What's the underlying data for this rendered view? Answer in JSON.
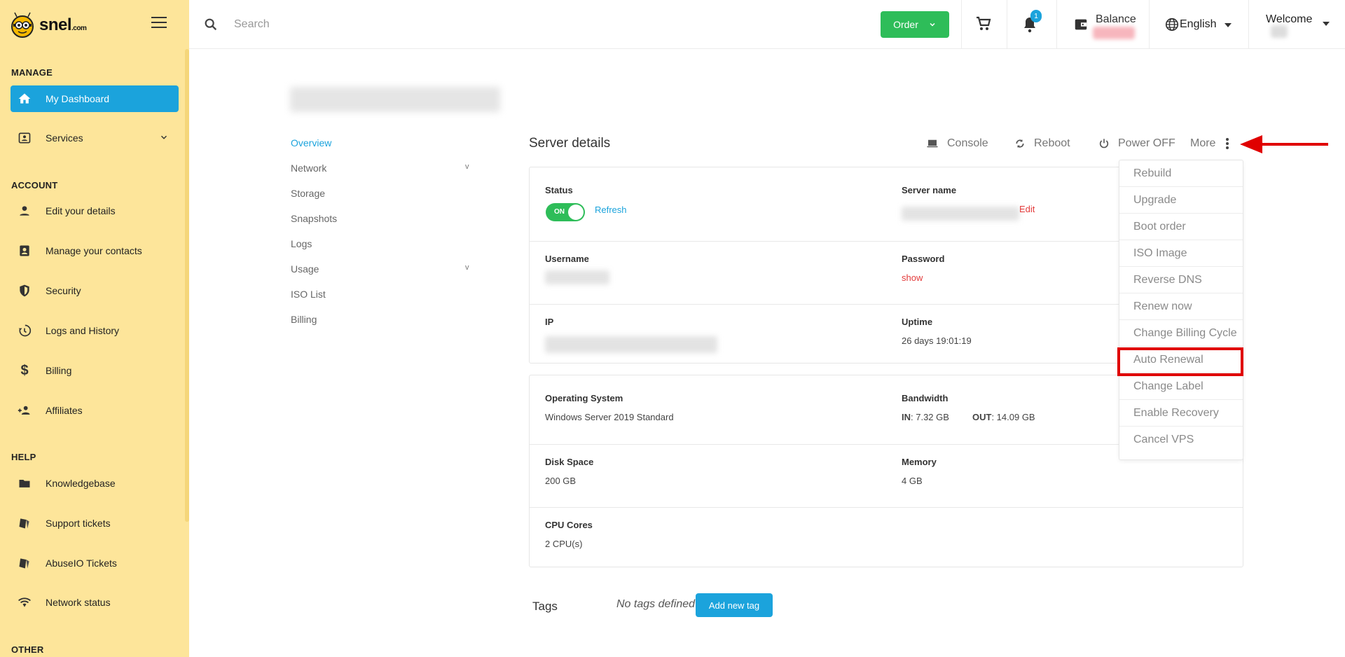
{
  "brand": {
    "name": "snel",
    "suffix": ".com"
  },
  "sidebar": {
    "sections": {
      "manage": "MANAGE",
      "account": "ACCOUNT",
      "help": "HELP",
      "other": "OTHER"
    },
    "items": [
      {
        "label": "My Dashboard",
        "icon": "home-icon"
      },
      {
        "label": "Services",
        "icon": "services-icon"
      },
      {
        "label": "Edit your details",
        "icon": "person-icon"
      },
      {
        "label": "Manage your contacts",
        "icon": "contacts-icon"
      },
      {
        "label": "Security",
        "icon": "shield-icon"
      },
      {
        "label": "Logs and History",
        "icon": "history-icon"
      },
      {
        "label": "Billing",
        "icon": "dollar-icon"
      },
      {
        "label": "Affiliates",
        "icon": "people-add-icon"
      },
      {
        "label": "Knowledgebase",
        "icon": "folder-icon"
      },
      {
        "label": "Support tickets",
        "icon": "ticket-icon"
      },
      {
        "label": "AbuseIO Tickets",
        "icon": "ticket-icon"
      },
      {
        "label": "Network status",
        "icon": "wifi-icon"
      }
    ]
  },
  "topbar": {
    "search_placeholder": "Search",
    "order_label": "Order",
    "notifications_count": "1",
    "balance_label": "Balance",
    "language_label": "English",
    "welcome_label": "Welcome"
  },
  "subnav": {
    "items": [
      "Overview",
      "Network",
      "Storage",
      "Snapshots",
      "Logs",
      "Usage",
      "ISO List",
      "Billing"
    ],
    "expand_marker": "v"
  },
  "server": {
    "title": "Server details",
    "actions": {
      "console": "Console",
      "reboot": "Reboot",
      "power_off": "Power OFF",
      "more": "More"
    },
    "status_label": "Status",
    "toggle_text": "ON",
    "refresh": "Refresh",
    "server_name_label": "Server name",
    "edit": "Edit",
    "username_label": "Username",
    "password_label": "Password",
    "password_show": "show",
    "ip_label": "IP",
    "uptime_label": "Uptime",
    "uptime_value": "26 days 19:01:19",
    "os_label": "Operating System",
    "os_value": "Windows Server 2019 Standard",
    "bandwidth_label": "Bandwidth",
    "bw_in_label": "IN",
    "bw_in_value": ": 7.32 GB",
    "bw_out_label": "OUT",
    "bw_out_value": ": 14.09 GB",
    "disk_label": "Disk Space",
    "disk_value": "200 GB",
    "memory_label": "Memory",
    "memory_value": "4 GB",
    "cpu_label": "CPU Cores",
    "cpu_value": "2 CPU(s)"
  },
  "more_menu": {
    "items": [
      "Rebuild",
      "Upgrade",
      "Boot order",
      "ISO Image",
      "Reverse DNS",
      "Renew now",
      "Change Billing Cycle",
      "Auto Renewal",
      "Change Label",
      "Enable Recovery",
      "Cancel VPS"
    ]
  },
  "tags": {
    "label": "Tags",
    "empty_text": "No tags defined",
    "add_button": "Add new tag"
  },
  "colors": {
    "sidebar_bg": "#fde59a",
    "accent_blue": "#1ba3dc",
    "green": "#2ebd59",
    "red": "#e00000"
  }
}
